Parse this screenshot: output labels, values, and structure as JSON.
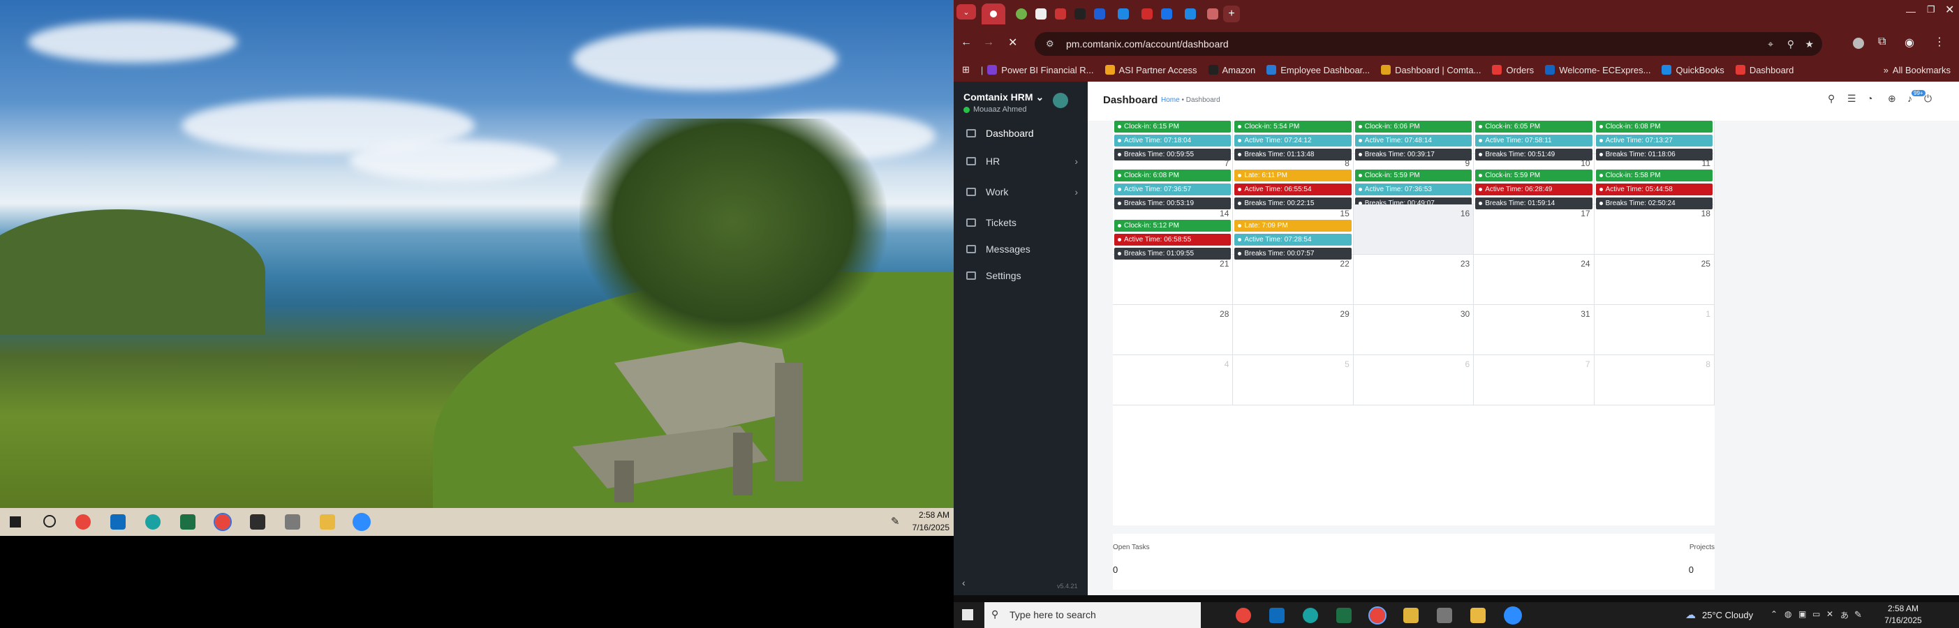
{
  "left_screen": {
    "taskbar": {
      "time": "2:58 AM",
      "date": "7/16/2025"
    }
  },
  "browser": {
    "url": "pm.comtanix.com/account/dashboard",
    "bookmarks": [
      "Power BI Financial R...",
      "ASI Partner Access",
      "Amazon",
      "Employee Dashboar...",
      "Dashboard | Comta...",
      "Orders",
      "Welcome- ECExpres...",
      "QuickBooks",
      "Dashboard"
    ],
    "all_bookmarks": "All Bookmarks",
    "bookmark_colors": [
      "#7b3fd1",
      "#f0a31c",
      "#222222",
      "#2a7bd4",
      "#e0a21a",
      "#e53935",
      "#1565c0",
      "#1e88e5",
      "#e53935"
    ]
  },
  "sidebar": {
    "app_name": "Comtanix HRM",
    "user": "Mouaaz Ahmed",
    "items": [
      {
        "label": "Dashboard"
      },
      {
        "label": "HR"
      },
      {
        "label": "Work"
      },
      {
        "label": "Tickets"
      },
      {
        "label": "Messages"
      },
      {
        "label": "Settings"
      }
    ],
    "version": "v5.4.21"
  },
  "main": {
    "title": "Dashboard",
    "breadcrumb_home": "Home",
    "breadcrumb_sep": "•",
    "breadcrumb_current": "Dashboard",
    "notif_count": "99+"
  },
  "calendar": {
    "weeks": [
      [
        {
          "day": "",
          "dim": false,
          "events": [
            {
              "c": "g",
              "t": "Clock-in: 6:15 PM"
            },
            {
              "c": "t",
              "t": "Active Time: 07:18:04"
            },
            {
              "c": "k",
              "t": "Breaks Time: 00:59:55"
            }
          ]
        },
        {
          "day": "",
          "dim": false,
          "events": [
            {
              "c": "g",
              "t": "Clock-in: 5:54 PM"
            },
            {
              "c": "t",
              "t": "Active Time: 07:24:12"
            },
            {
              "c": "k",
              "t": "Breaks Time: 01:13:48"
            }
          ]
        },
        {
          "day": "",
          "dim": false,
          "events": [
            {
              "c": "g",
              "t": "Clock-in: 6:06 PM"
            },
            {
              "c": "t",
              "t": "Active Time: 07:48:14"
            },
            {
              "c": "k",
              "t": "Breaks Time: 00:39:17"
            }
          ]
        },
        {
          "day": "",
          "dim": false,
          "events": [
            {
              "c": "g",
              "t": "Clock-in: 6:05 PM"
            },
            {
              "c": "t",
              "t": "Active Time: 07:58:11"
            },
            {
              "c": "k",
              "t": "Breaks Time: 00:51:49"
            }
          ]
        },
        {
          "day": "",
          "dim": false,
          "events": [
            {
              "c": "g",
              "t": "Clock-in: 6:08 PM"
            },
            {
              "c": "t",
              "t": "Active Time: 07:13:27"
            },
            {
              "c": "k",
              "t": "Breaks Time: 01:18:06"
            }
          ]
        }
      ],
      [
        {
          "day": "7",
          "dim": false,
          "events": [
            {
              "c": "g",
              "t": "Clock-in: 6:08 PM"
            },
            {
              "c": "t",
              "t": "Active Time: 07:36:57"
            },
            {
              "c": "k",
              "t": "Breaks Time: 00:53:19"
            }
          ]
        },
        {
          "day": "8",
          "dim": false,
          "events": [
            {
              "c": "y",
              "t": "Late: 6:11 PM"
            },
            {
              "c": "r",
              "t": "Active Time: 06:55:54"
            },
            {
              "c": "k",
              "t": "Breaks Time: 00:22:15"
            }
          ]
        },
        {
          "day": "9",
          "dim": false,
          "events": [
            {
              "c": "g",
              "t": "Clock-in: 5:59 PM"
            },
            {
              "c": "t",
              "t": "Active Time: 07:36:53"
            },
            {
              "c": "k",
              "t": "Breaks Time: 00:49:07"
            }
          ]
        },
        {
          "day": "10",
          "dim": false,
          "events": [
            {
              "c": "g",
              "t": "Clock-in: 5:59 PM"
            },
            {
              "c": "r",
              "t": "Active Time: 06:28:49"
            },
            {
              "c": "k",
              "t": "Breaks Time: 01:59:14"
            }
          ]
        },
        {
          "day": "11",
          "dim": false,
          "events": [
            {
              "c": "g",
              "t": "Clock-in: 5:58 PM"
            },
            {
              "c": "r",
              "t": "Active Time: 05:44:58"
            },
            {
              "c": "k",
              "t": "Breaks Time: 02:50:24"
            }
          ]
        }
      ],
      [
        {
          "day": "14",
          "dim": false,
          "events": [
            {
              "c": "g",
              "t": "Clock-in: 5:12 PM"
            },
            {
              "c": "r",
              "t": "Active Time: 06:58:55"
            },
            {
              "c": "k",
              "t": "Breaks Time: 01:09:55"
            }
          ]
        },
        {
          "day": "15",
          "dim": false,
          "events": [
            {
              "c": "y",
              "t": "Late: 7:09 PM"
            },
            {
              "c": "t",
              "t": "Active Time: 07:28:54"
            },
            {
              "c": "k",
              "t": "Breaks Time: 00:07:57"
            }
          ]
        },
        {
          "day": "16",
          "dim": false,
          "today": true,
          "events": []
        },
        {
          "day": "17",
          "dim": false,
          "events": []
        },
        {
          "day": "18",
          "dim": false,
          "events": []
        }
      ],
      [
        {
          "day": "21",
          "dim": false,
          "events": []
        },
        {
          "day": "22",
          "dim": false,
          "events": []
        },
        {
          "day": "23",
          "dim": false,
          "events": []
        },
        {
          "day": "24",
          "dim": false,
          "events": []
        },
        {
          "day": "25",
          "dim": false,
          "events": []
        }
      ],
      [
        {
          "day": "28",
          "dim": false,
          "events": []
        },
        {
          "day": "29",
          "dim": false,
          "events": []
        },
        {
          "day": "30",
          "dim": false,
          "events": []
        },
        {
          "day": "31",
          "dim": false,
          "events": []
        },
        {
          "day": "1",
          "dim": true,
          "events": []
        }
      ],
      [
        {
          "day": "4",
          "dim": true,
          "events": []
        },
        {
          "day": "5",
          "dim": true,
          "events": []
        },
        {
          "day": "6",
          "dim": true,
          "events": []
        },
        {
          "day": "7",
          "dim": true,
          "events": []
        },
        {
          "day": "8",
          "dim": true,
          "events": []
        }
      ]
    ]
  },
  "stats": {
    "open_tasks_label": "Open Tasks",
    "open_tasks_value": "0",
    "projects_label": "Projects",
    "projects_value": "0"
  },
  "taskbar": {
    "search_placeholder": "Type here to search",
    "weather": "25°C  Cloudy",
    "time": "2:58 AM",
    "date": "7/16/2025"
  }
}
